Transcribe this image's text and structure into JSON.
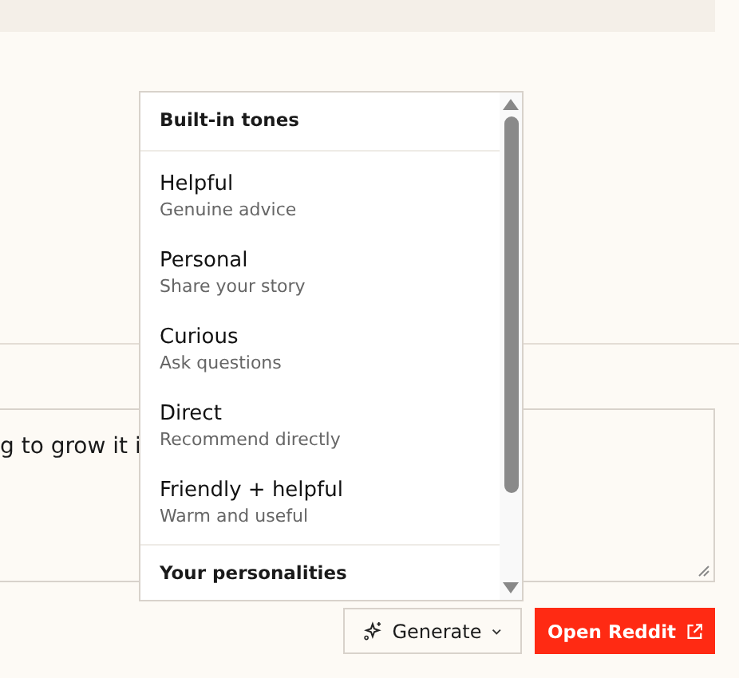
{
  "reply_field": {
    "value": "g to grow it i"
  },
  "tone_menu": {
    "sections": [
      {
        "heading": "Built-in tones",
        "items": [
          {
            "label": "Helpful",
            "description": "Genuine advice"
          },
          {
            "label": "Personal",
            "description": "Share your story"
          },
          {
            "label": "Curious",
            "description": "Ask questions"
          },
          {
            "label": "Direct",
            "description": "Recommend directly"
          },
          {
            "label": "Friendly + helpful",
            "description": "Warm and useful"
          }
        ]
      },
      {
        "heading": "Your personalities"
      }
    ]
  },
  "buttons": {
    "generate": "Generate",
    "open": "Open Reddit"
  }
}
